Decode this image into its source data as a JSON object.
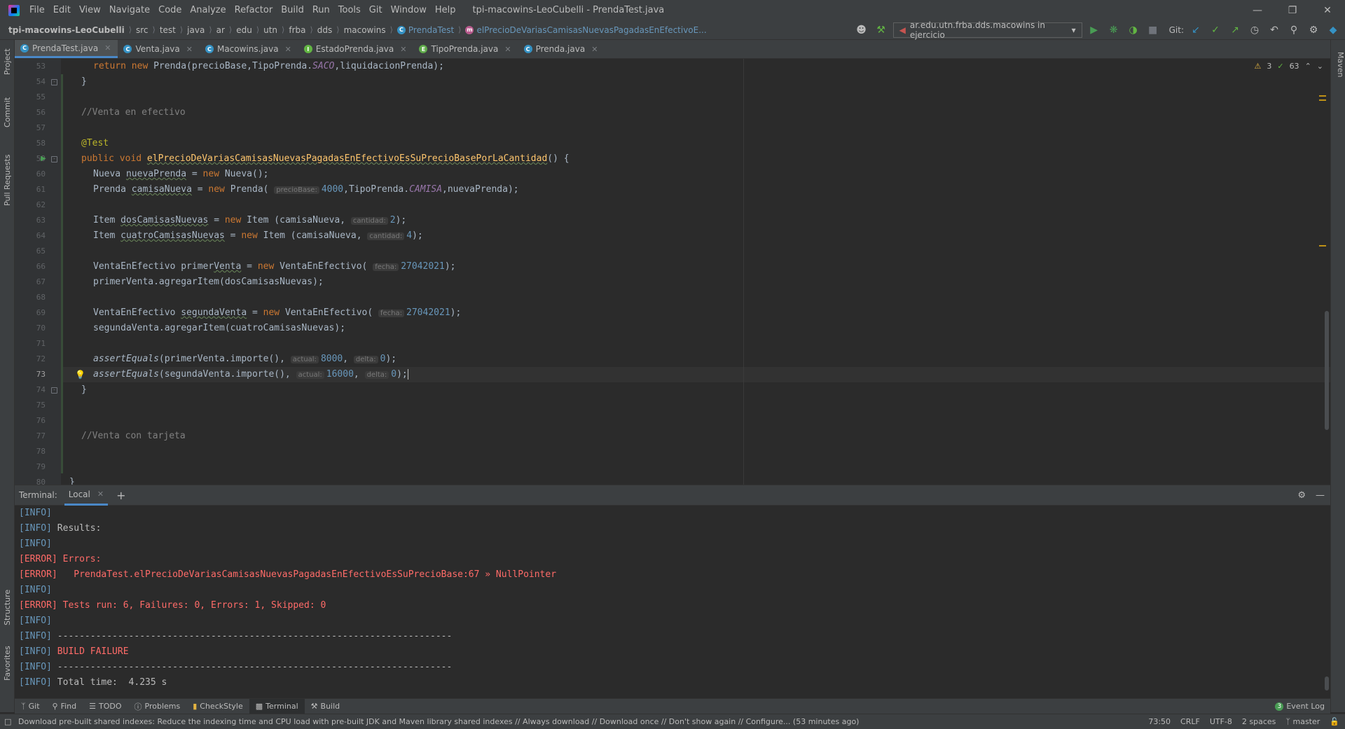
{
  "menubar": {
    "items": [
      "File",
      "Edit",
      "View",
      "Navigate",
      "Code",
      "Analyze",
      "Refactor",
      "Build",
      "Run",
      "Tools",
      "Git",
      "Window",
      "Help"
    ],
    "window_title": "tpi-macowins-LeoCubelli - PrendaTest.java"
  },
  "breadcrumb": {
    "items": [
      "tpi-macowins-LeoCubelli",
      "src",
      "test",
      "java",
      "ar",
      "edu",
      "utn",
      "frba",
      "dds",
      "macowins"
    ],
    "class_name": "PrendaTest",
    "method_name": "elPrecioDeVariasCamisasNuevasPagadasEnEfectivoE..."
  },
  "toolbar": {
    "run_config": "ar.edu.utn.frba.dds.macowins in ejercicio",
    "git_label": "Git:"
  },
  "left_tools": [
    "Project",
    "Commit",
    "Pull Requests",
    "Structure",
    "Favorites"
  ],
  "right_tools": [
    "Maven"
  ],
  "tabs": [
    {
      "label": "PrendaTest.java",
      "icon": "C",
      "active": true
    },
    {
      "label": "Venta.java",
      "icon": "C",
      "active": false
    },
    {
      "label": "Macowins.java",
      "icon": "C",
      "active": false
    },
    {
      "label": "EstadoPrenda.java",
      "icon": "I",
      "active": false
    },
    {
      "label": "TipoPrenda.java",
      "icon": "E",
      "active": false
    },
    {
      "label": "Prenda.java",
      "icon": "C",
      "active": false
    }
  ],
  "inspections": {
    "warnings": "3",
    "ok": "63"
  },
  "editor": {
    "line_numbers": [
      "53",
      "54",
      "55",
      "56",
      "57",
      "58",
      "59",
      "60",
      "61",
      "62",
      "63",
      "64",
      "65",
      "66",
      "67",
      "68",
      "69",
      "70",
      "71",
      "72",
      "73",
      "74",
      "75",
      "76",
      "77",
      "78",
      "79",
      "80"
    ],
    "current_line": "73",
    "code": {
      "l53_kw": "return new ",
      "l53_a": "Prenda(precioBase,TipoPrenda.",
      "l53_enum": "SACO",
      "l53_b": ",liquidacionPrenda);",
      "l54": "}",
      "l56": "//Venta en efectivo",
      "l58": "@Test",
      "l59_kw": "public void ",
      "l59_m": "elPrecioDeVariasCamisasNuevasPagadasEnEfectivoEsSuPrecioBasePorLaCantidad",
      "l59_b": "() {",
      "l60_a": "Nueva ",
      "l60_var": "nuevaPrenda",
      "l60_b": " = ",
      "l60_kw": "new ",
      "l60_c": "Nueva();",
      "l61_a": "Prenda ",
      "l61_var": "camisaNueva",
      "l61_b": " = ",
      "l61_kw": "new ",
      "l61_c": "Prenda( ",
      "l61_hint": "precioBase:",
      "l61_num": "4000",
      "l61_d": ",TipoPrenda.",
      "l61_enum": "CAMISA",
      "l61_e": ",nuevaPrenda);",
      "l63_a": "Item ",
      "l63_var": "dosCamisasNuevas",
      "l63_b": " = ",
      "l63_kw": "new ",
      "l63_c": "Item (camisaNueva, ",
      "l63_hint": "cantidad:",
      "l63_num": "2",
      "l63_d": ");",
      "l64_a": "Item ",
      "l64_var": "cuatroCamisasNuevas",
      "l64_b": " = ",
      "l64_kw": "new ",
      "l64_c": "Item (camisaNueva, ",
      "l64_hint": "cantidad:",
      "l64_num": "4",
      "l64_d": ");",
      "l66_a": "VentaEnEfectivo primer",
      "l66_var": "Venta",
      "l66_b": " = ",
      "l66_kw": "new ",
      "l66_c": "VentaEnEfectivo( ",
      "l66_hint": "fecha:",
      "l66_num": "27042021",
      "l66_d": ");",
      "l67": "primerVenta.agregarItem(dosCamisasNuevas);",
      "l69_a": "VentaEnEfectivo ",
      "l69_var": "segundaVenta",
      "l69_b": " = ",
      "l69_kw": "new ",
      "l69_c": "VentaEnEfectivo( ",
      "l69_hint": "fecha:",
      "l69_num": "27042021",
      "l69_d": ");",
      "l70": "segundaVenta.agregarItem(cuatroCamisasNuevas);",
      "l72_m": "assertEquals",
      "l72_a": "(primerVenta.importe(), ",
      "l72_hint1": "actual:",
      "l72_num1": "8000",
      "l72_c": ", ",
      "l72_hint2": "delta:",
      "l72_num2": "0",
      "l72_d": ");",
      "l73_m": "assertEquals",
      "l73_a": "(segundaVenta.importe(), ",
      "l73_hint1": "actual:",
      "l73_num1": "16000",
      "l73_c": ", ",
      "l73_hint2": "delta:",
      "l73_num2": "0",
      "l73_d": ");",
      "l74": "}",
      "l77": "//Venta con tarjeta",
      "l80": "}"
    }
  },
  "terminal": {
    "label": "Terminal:",
    "tab": "Local",
    "lines": [
      {
        "tag": "[INFO]",
        "type": "info",
        "text": ""
      },
      {
        "tag": "[INFO]",
        "type": "info",
        "text": " Results:"
      },
      {
        "tag": "[INFO]",
        "type": "info",
        "text": ""
      },
      {
        "tag": "[ERROR]",
        "type": "error",
        "text": " Errors:"
      },
      {
        "tag": "[ERROR]",
        "type": "error",
        "text": "   PrendaTest.elPrecioDeVariasCamisasNuevasPagadasEnEfectivoEsSuPrecioBase:67 » NullPointer"
      },
      {
        "tag": "[INFO]",
        "type": "info",
        "text": ""
      },
      {
        "tag": "[ERROR]",
        "type": "error",
        "text": " Tests run: 6, Failures: 0, Errors: 1, Skipped: 0"
      },
      {
        "tag": "[INFO]",
        "type": "info",
        "text": ""
      },
      {
        "tag": "[INFO]",
        "type": "info",
        "text": " ------------------------------------------------------------------------"
      },
      {
        "tag": "[INFO]",
        "type": "info-err",
        "text": " BUILD FAILURE"
      },
      {
        "tag": "[INFO]",
        "type": "info",
        "text": " ------------------------------------------------------------------------"
      },
      {
        "tag": "[INFO]",
        "type": "info",
        "text": " Total time:  4.235 s"
      }
    ]
  },
  "toolwindows": [
    "Git",
    "Find",
    "TODO",
    "Problems",
    "CheckStyle",
    "Terminal",
    "Build"
  ],
  "event_log": "Event Log",
  "event_log_count": "3",
  "status": {
    "message": "Download pre-built shared indexes: Reduce the indexing time and CPU load with pre-built JDK and Maven library shared indexes // Always download // Download once // Don't show again // Configure... (53 minutes ago)",
    "position": "73:50",
    "line_sep": "CRLF",
    "encoding": "UTF-8",
    "indent": "2 spaces",
    "branch": "master"
  }
}
